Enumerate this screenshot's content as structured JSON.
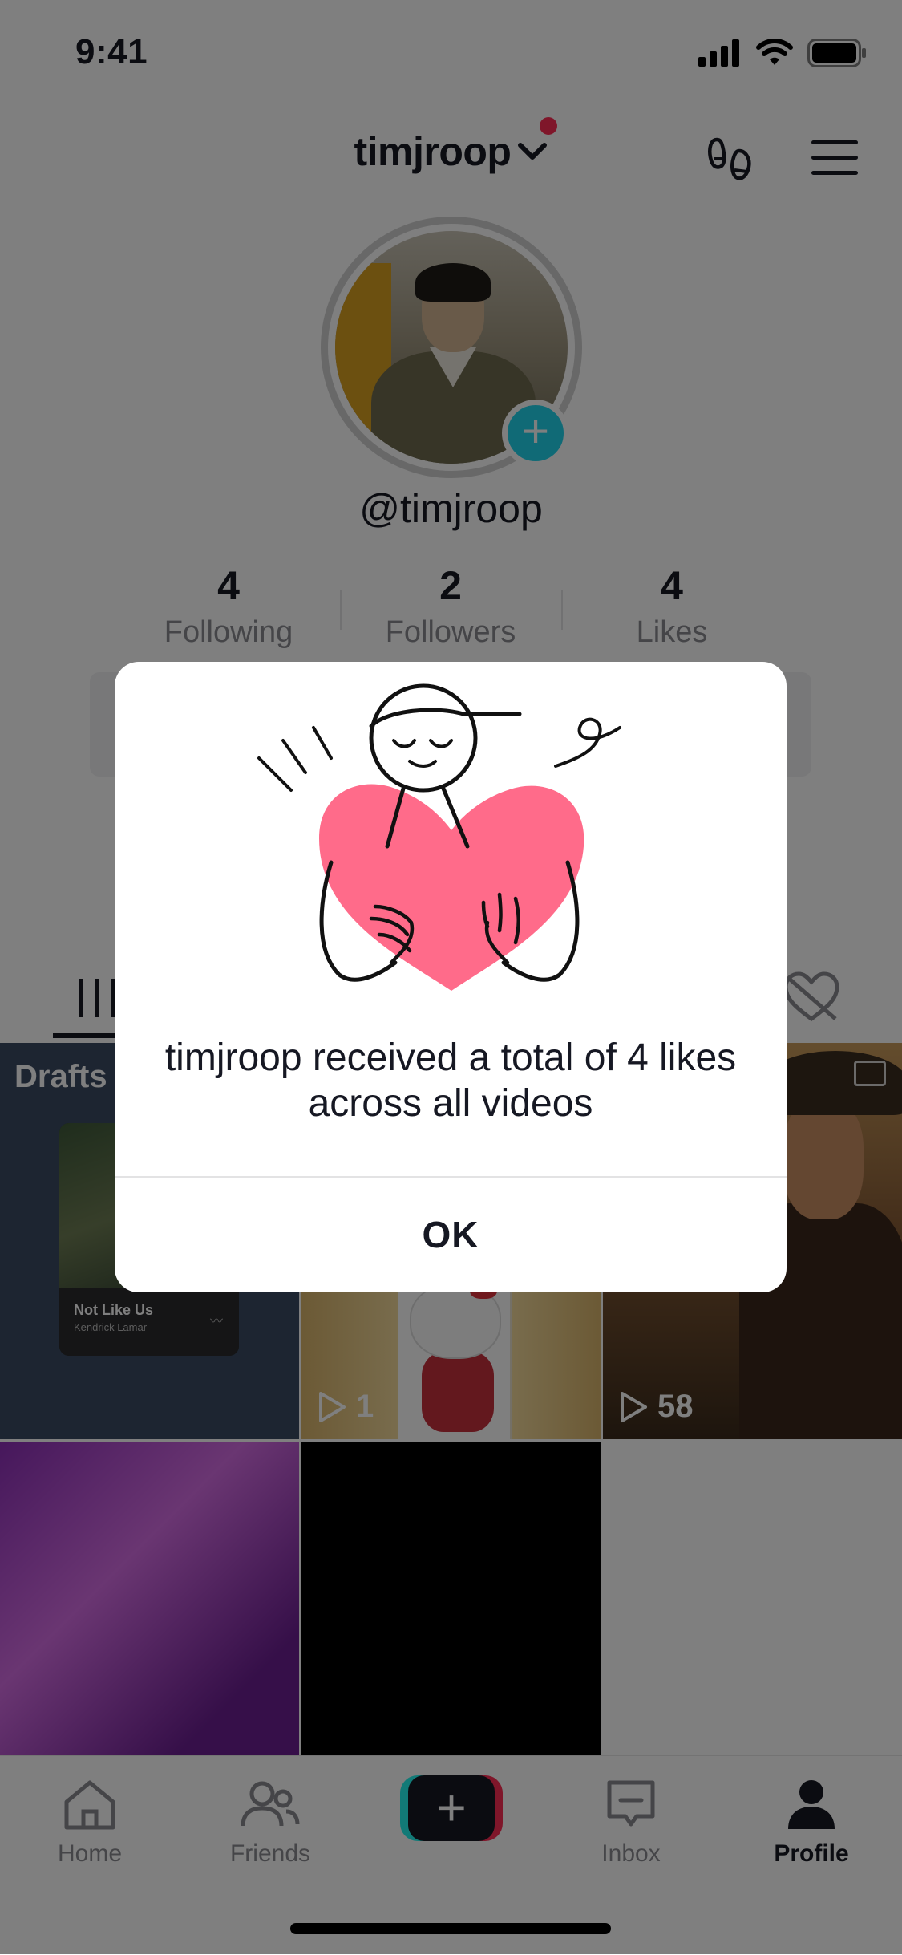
{
  "status_bar": {
    "time": "9:41"
  },
  "header": {
    "username": "timjroop"
  },
  "profile": {
    "handle": "@timjroop",
    "stats": [
      {
        "value": "4",
        "label": "Following"
      },
      {
        "value": "2",
        "label": "Followers"
      },
      {
        "value": "4",
        "label": "Likes"
      }
    ]
  },
  "grid": {
    "drafts_label": "Drafts",
    "drafts_song_title": "Not Like Us",
    "drafts_song_artist": "Kendrick Lamar",
    "items": [
      {
        "plays": "1"
      },
      {
        "plays": "58"
      }
    ]
  },
  "tabbar": {
    "items": [
      {
        "label": "Home",
        "icon": "home-icon"
      },
      {
        "label": "Friends",
        "icon": "friends-icon"
      },
      {
        "label": "",
        "icon": "create-plus-icon"
      },
      {
        "label": "Inbox",
        "icon": "inbox-icon"
      },
      {
        "label": "Profile",
        "icon": "profile-icon"
      }
    ]
  },
  "dialog": {
    "message": "timjroop received a total of 4 likes across all videos",
    "ok_label": "OK",
    "illustration": "heart-hug-illustration"
  },
  "colors": {
    "accent_pink": "#fe2c55",
    "accent_cyan": "#25f4ee",
    "badge_teal": "#20d5ec",
    "heart": "#ff6b8a",
    "text_primary": "#161823",
    "text_secondary": "#8a8b91"
  }
}
